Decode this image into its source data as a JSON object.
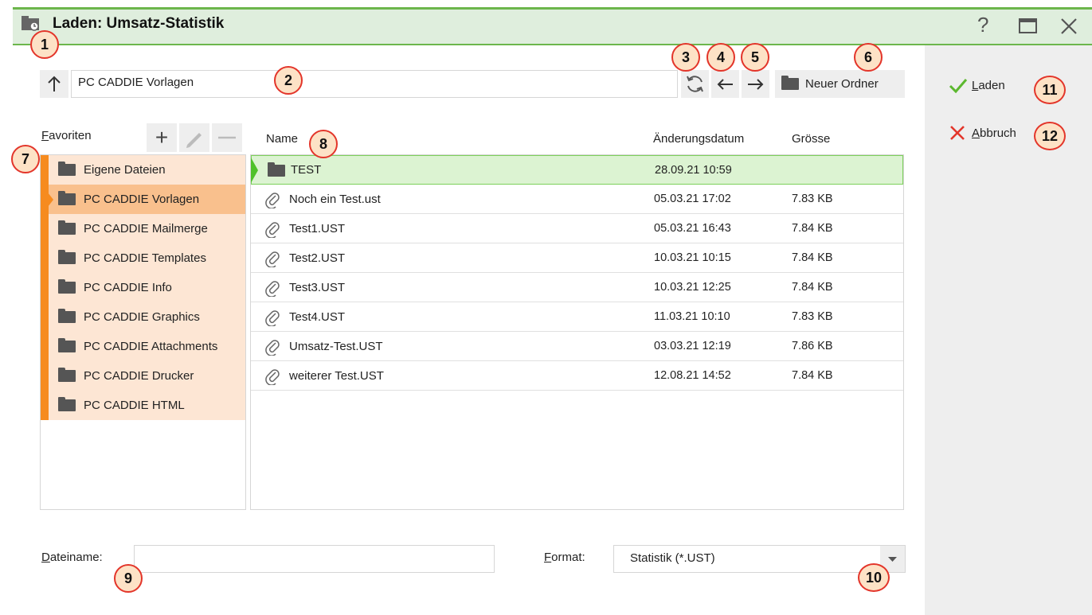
{
  "window": {
    "title": "Laden: Umsatz-Statistik",
    "help": "?",
    "maximize": "□",
    "close": "✕"
  },
  "path": {
    "value": "PC CADDIE Vorlagen",
    "up_icon": "arrow-up-icon"
  },
  "toolbar": {
    "new_folder_label": "Neuer Ordner"
  },
  "favorites": {
    "label_first": "F",
    "label_rest": "avoriten",
    "add": "+",
    "edit": "✎",
    "remove": "—",
    "items": [
      {
        "label": "Eigene Dateien"
      },
      {
        "label": "PC CADDIE Vorlagen",
        "selected": true
      },
      {
        "label": "PC CADDIE Mailmerge"
      },
      {
        "label": "PC CADDIE Templates"
      },
      {
        "label": "PC CADDIE Info"
      },
      {
        "label": "PC CADDIE Graphics"
      },
      {
        "label": "PC CADDIE Attachments"
      },
      {
        "label": "PC CADDIE Drucker"
      },
      {
        "label": "PC CADDIE HTML"
      }
    ]
  },
  "files": {
    "columns": {
      "name": "Name",
      "date": "Änderungsdatum",
      "size": "Grösse"
    },
    "rows": [
      {
        "name": "TEST",
        "date": "28.09.21 10:59",
        "size": "",
        "type": "folder",
        "selected": true
      },
      {
        "name": "Noch ein Test.ust",
        "date": "05.03.21 17:02",
        "size": "7.83 KB",
        "type": "file"
      },
      {
        "name": "Test1.UST",
        "date": "05.03.21 16:43",
        "size": "7.84 KB",
        "type": "file"
      },
      {
        "name": "Test2.UST",
        "date": "10.03.21 10:15",
        "size": "7.84 KB",
        "type": "file"
      },
      {
        "name": "Test3.UST",
        "date": "10.03.21 12:25",
        "size": "7.84 KB",
        "type": "file"
      },
      {
        "name": "Test4.UST",
        "date": "11.03.21 10:10",
        "size": "7.83 KB",
        "type": "file"
      },
      {
        "name": "Umsatz-Test.UST",
        "date": "03.03.21 12:19",
        "size": "7.86 KB",
        "type": "file"
      },
      {
        "name": "weiterer Test.UST",
        "date": "12.08.21 14:52",
        "size": "7.84 KB",
        "type": "file"
      }
    ]
  },
  "filename": {
    "label_first": "D",
    "label_rest": "ateiname:",
    "value": ""
  },
  "format": {
    "label_first": "F",
    "label_rest": "ormat:",
    "value": "Statistik (*.UST)"
  },
  "actions": {
    "load_first": "L",
    "load_rest": "aden",
    "cancel_first": "A",
    "cancel_rest": "bbruch"
  },
  "callouts": [
    "1",
    "2",
    "3",
    "4",
    "5",
    "6",
    "7",
    "8",
    "9",
    "10",
    "11",
    "12"
  ],
  "colors": {
    "accent_green": "#6cb64c",
    "accent_orange": "#f68b1f",
    "cancel_red": "#e3352a"
  }
}
